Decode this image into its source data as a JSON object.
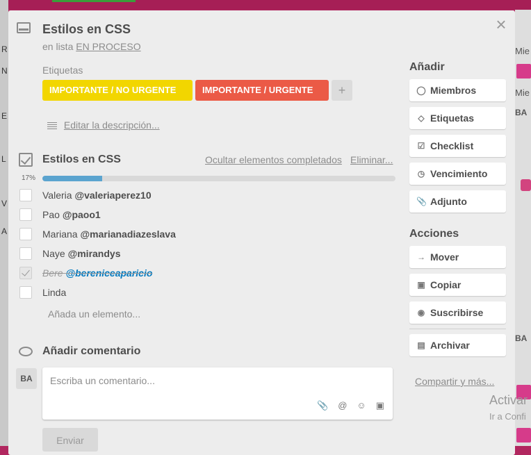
{
  "card": {
    "title": "Estilos en CSS",
    "in_list_prefix": "en lista",
    "list_name": "EN PROCESO",
    "close": "×"
  },
  "labels": {
    "title": "Etiquetas",
    "items": [
      "IMPORTANTE / NO URGENTE",
      "IMPORTANTE / URGENTE"
    ],
    "colors": [
      "#f2d600",
      "#eb5a46"
    ],
    "add": "+"
  },
  "description": {
    "edit_link": "Editar la descripción..."
  },
  "checklist": {
    "title": "Estilos en CSS",
    "hide_completed": "Ocultar elementos completados",
    "delete": "Eliminar...",
    "progress_label": "17%",
    "progress": 17,
    "items": [
      {
        "name": "Valeria",
        "user": "@valeriaperez10",
        "done": false
      },
      {
        "name": "Pao",
        "user": "@paoo1",
        "done": false
      },
      {
        "name": "Mariana",
        "user": "@marianadiazeslava",
        "done": false
      },
      {
        "name": "Naye",
        "user": "@mirandys",
        "done": false
      },
      {
        "name": "Bere",
        "user": "@bereniceaparicio",
        "done": true
      },
      {
        "name": "Linda",
        "user": "",
        "done": false
      }
    ],
    "add_item": "Añada un elemento..."
  },
  "comments": {
    "title": "Añadir comentario",
    "avatar": "BA",
    "placeholder": "Escriba un comentario...",
    "send": "Enviar"
  },
  "sidebar": {
    "add_title": "Añadir",
    "add_buttons": [
      "Miembros",
      "Etiquetas",
      "Checklist",
      "Vencimiento",
      "Adjunto"
    ],
    "actions_title": "Acciones",
    "action_buttons": [
      "Mover",
      "Copiar",
      "Suscribirse",
      "Archivar"
    ],
    "share": "Compartir y más..."
  },
  "background": {
    "right_fragments": [
      "Mie",
      "Mie",
      "BA",
      "BA"
    ],
    "left_fragments": [
      "R",
      "N",
      "E",
      "L",
      "V",
      "A"
    ],
    "watermark_line1": "Activar",
    "watermark_line2": "Ir a Confi"
  }
}
